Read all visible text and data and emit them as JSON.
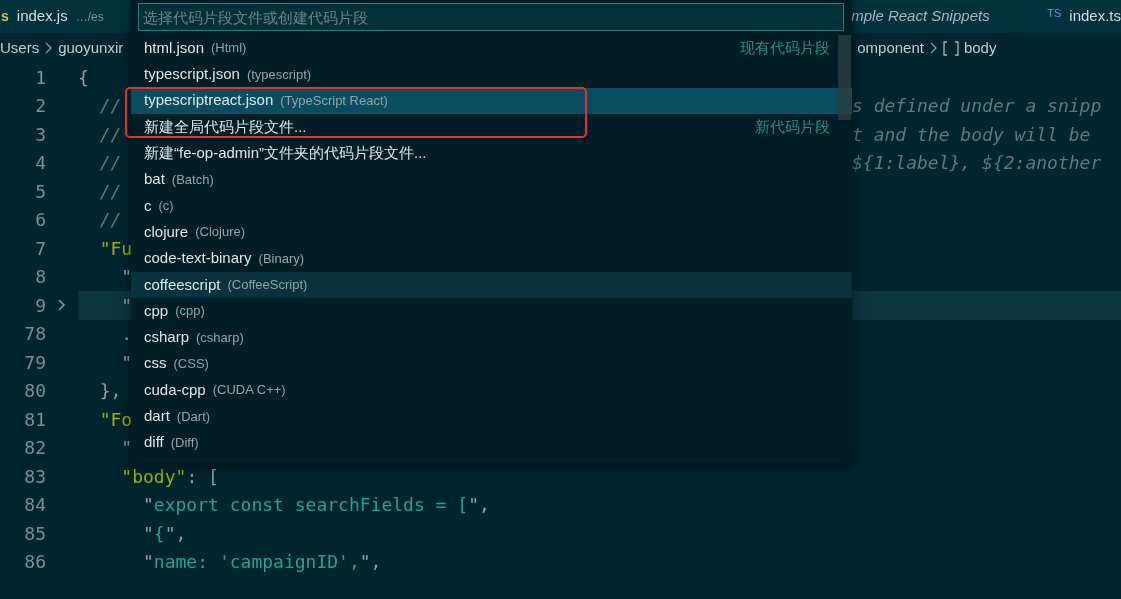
{
  "tabs": [
    {
      "icon": "s",
      "label": "index.js",
      "path": "…/es",
      "kind": "normal"
    },
    {
      "label": "mple React Snippets",
      "kind": "preview"
    },
    {
      "icon": "TS",
      "label": "index.ts",
      "kind": "normal"
    }
  ],
  "breadcrumb": {
    "left": [
      "Users",
      "guoyunxir"
    ],
    "right": [
      "omponent",
      "body"
    ]
  },
  "lines": [
    {
      "number": "1",
      "folded": false,
      "current": false,
      "left": [
        {
          "text": "{",
          "kind": "punct"
        }
      ]
    },
    {
      "number": "2",
      "folded": false,
      "current": false,
      "left": [
        {
          "text": "  //",
          "kind": "comment"
        }
      ],
      "right": [
        {
          "text": "s defined under a snipp",
          "kind": "comment"
        }
      ]
    },
    {
      "number": "3",
      "folded": false,
      "current": false,
      "left": [
        {
          "text": "  //",
          "kind": "comment"
        }
      ],
      "right": [
        {
          "text": "t and the body will be",
          "kind": "comment"
        }
      ]
    },
    {
      "number": "4",
      "folded": false,
      "current": false,
      "left": [
        {
          "text": "  //",
          "kind": "comment"
        }
      ],
      "right": [
        {
          "text": "${1:label}, ${2:another",
          "kind": "comment"
        }
      ]
    },
    {
      "number": "5",
      "folded": false,
      "current": false,
      "left": [
        {
          "text": "  //",
          "kind": "comment"
        }
      ]
    },
    {
      "number": "6",
      "folded": false,
      "current": false,
      "left": [
        {
          "text": "  //",
          "kind": "comment"
        }
      ]
    },
    {
      "number": "7",
      "folded": false,
      "current": false,
      "left": [
        {
          "text": "  \"Fu",
          "kind": "key"
        }
      ]
    },
    {
      "number": "8",
      "folded": false,
      "current": false,
      "left": [
        {
          "text": "    \"",
          "kind": "punct"
        }
      ]
    },
    {
      "number": "9",
      "folded": true,
      "current": true,
      "left": [
        {
          "text": "    \"",
          "kind": "punct"
        }
      ]
    },
    {
      "number": "78",
      "folded": false,
      "current": false,
      "left": [
        {
          "text": "    .",
          "kind": "punct"
        }
      ]
    },
    {
      "number": "79",
      "folded": false,
      "current": false,
      "left": [
        {
          "text": "    \"",
          "kind": "punct"
        }
      ]
    },
    {
      "number": "80",
      "folded": false,
      "current": false,
      "left": [
        {
          "text": "  },",
          "kind": "punct"
        }
      ]
    },
    {
      "number": "81",
      "folded": false,
      "current": false,
      "left": [
        {
          "text": "  \"Fo",
          "kind": "key"
        }
      ]
    },
    {
      "number": "82",
      "folded": false,
      "current": false,
      "left": [
        {
          "text": "    \"",
          "kind": "punct"
        }
      ]
    },
    {
      "number": "83",
      "folded": false,
      "current": false,
      "left": [
        {
          "text": "    \"body\"",
          "kind": "key"
        },
        {
          "text": ": [",
          "kind": "punct"
        }
      ]
    },
    {
      "number": "84",
      "folded": false,
      "current": false,
      "left": [
        {
          "text": "      \"",
          "kind": "punct"
        },
        {
          "text": "export const searchFields = [",
          "kind": "string"
        },
        {
          "text": "\",",
          "kind": "punct"
        }
      ]
    },
    {
      "number": "85",
      "folded": false,
      "current": false,
      "left": [
        {
          "text": "      \"",
          "kind": "punct"
        },
        {
          "text": "{",
          "kind": "string"
        },
        {
          "text": "\",",
          "kind": "punct"
        }
      ]
    },
    {
      "number": "86",
      "folded": false,
      "current": false,
      "left": [
        {
          "text": "      \"",
          "kind": "punct"
        },
        {
          "text": "name: 'campaignID',",
          "kind": "string"
        },
        {
          "text": "\",",
          "kind": "punct"
        }
      ]
    }
  ],
  "quick_pick": {
    "placeholder": "选择代码片段文件或创建代码片段",
    "items": [
      {
        "label": "html.json",
        "description": "(Html)",
        "group": "现有代码片段",
        "selected": false,
        "hovered": false
      },
      {
        "label": "typescript.json",
        "description": "(typescript)",
        "selected": false,
        "hovered": false
      },
      {
        "label": "typescriptreact.json",
        "description": "(TypeScript React)",
        "selected": true,
        "hovered": false
      },
      {
        "label": "新建全局代码片段文件...",
        "group": "新代码片段",
        "selected": false,
        "hovered": false
      },
      {
        "label": "新建“fe-op-admin”文件夹的代码片段文件...",
        "selected": false,
        "hovered": false
      },
      {
        "label": "bat",
        "description": "(Batch)",
        "selected": false,
        "hovered": false
      },
      {
        "label": "c",
        "description": "(c)",
        "selected": false,
        "hovered": false
      },
      {
        "label": "clojure",
        "description": "(Clojure)",
        "selected": false,
        "hovered": false
      },
      {
        "label": "code-text-binary",
        "description": "(Binary)",
        "selected": false,
        "hovered": false
      },
      {
        "label": "coffeescript",
        "description": "(CoffeeScript)",
        "selected": false,
        "hovered": true
      },
      {
        "label": "cpp",
        "description": "(cpp)",
        "selected": false,
        "hovered": false
      },
      {
        "label": "csharp",
        "description": "(csharp)",
        "selected": false,
        "hovered": false
      },
      {
        "label": "css",
        "description": "(CSS)",
        "selected": false,
        "hovered": false
      },
      {
        "label": "cuda-cpp",
        "description": "(CUDA C++)",
        "selected": false,
        "hovered": false
      },
      {
        "label": "dart",
        "description": "(Dart)",
        "selected": false,
        "hovered": false
      },
      {
        "label": "diff",
        "description": "(Diff)",
        "selected": false,
        "hovered": false
      }
    ]
  }
}
